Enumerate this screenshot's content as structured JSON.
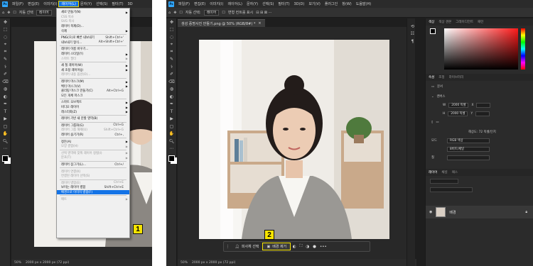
{
  "left": {
    "menubar": {
      "app_icon": "Ps",
      "items": [
        "파일(F)",
        "편집(E)",
        "이미지(I)",
        "레이어(L)",
        "문자(Y)",
        "선택(S)",
        "필터(T)",
        "3D"
      ],
      "active_index": 3
    },
    "optbar": {
      "auto_select": "자동 선택",
      "arrange": "레이어"
    },
    "status": {
      "zoom": "50%",
      "size": "2000 px x 2000 px (72 ppi)"
    },
    "menu": {
      "items": [
        {
          "label": "새로 만들기(N)",
          "shortcut": "",
          "state": "normal",
          "sub": true
        },
        {
          "label": "CSS 복사",
          "shortcut": "",
          "state": "disabled"
        },
        {
          "label": "SVG 복사",
          "shortcut": "",
          "state": "disabled"
        },
        {
          "label": "레이어 복제(D)...",
          "shortcut": "",
          "state": "normal"
        },
        {
          "label": "삭제",
          "shortcut": "",
          "state": "normal",
          "sub": true
        },
        {
          "sep": true
        },
        {
          "label": "PNG(으)로 빠른 내보내기",
          "shortcut": "Shift+Ctrl+'",
          "state": "normal"
        },
        {
          "label": "내보내기 형식...",
          "shortcut": "Alt+Shift+Ctrl+'",
          "state": "normal"
        },
        {
          "sep": true
        },
        {
          "label": "레이어 이름 바꾸기...",
          "shortcut": "",
          "state": "normal"
        },
        {
          "label": "레이어 스타일(Y)",
          "shortcut": "",
          "state": "normal",
          "sub": true
        },
        {
          "label": "스마트 필터",
          "shortcut": "",
          "state": "disabled",
          "sub": true
        },
        {
          "sep": true
        },
        {
          "label": "새 칠 레이어(W)",
          "shortcut": "",
          "state": "normal",
          "sub": true
        },
        {
          "label": "새 조정 레이어(J)",
          "shortcut": "",
          "state": "normal",
          "sub": true
        },
        {
          "label": "레이어 내용 옵션(O)...",
          "shortcut": "",
          "state": "disabled"
        },
        {
          "sep": true
        },
        {
          "label": "레이어 마스크(M)",
          "shortcut": "",
          "state": "normal",
          "sub": true
        },
        {
          "label": "벡터 마스크(V)",
          "shortcut": "",
          "state": "normal",
          "sub": true
        },
        {
          "label": "클리핑 마스크 만들기(C)",
          "shortcut": "Alt+Ctrl+G",
          "state": "normal"
        },
        {
          "label": "모든 개체 마스크",
          "shortcut": "",
          "state": "normal"
        },
        {
          "sep": true
        },
        {
          "label": "스마트 오브젝트",
          "shortcut": "",
          "state": "normal",
          "sub": true
        },
        {
          "label": "비디오 레이어",
          "shortcut": "",
          "state": "normal",
          "sub": true
        },
        {
          "label": "래스터화(Z)",
          "shortcut": "",
          "state": "normal",
          "sub": true
        },
        {
          "sep": true
        },
        {
          "label": "레이어 기반 새 분할 영역(B)",
          "shortcut": "",
          "state": "normal"
        },
        {
          "sep": true
        },
        {
          "label": "레이어 그룹화(G)",
          "shortcut": "Ctrl+G",
          "state": "normal"
        },
        {
          "label": "레이어 그룹 해제(U)",
          "shortcut": "Shift+Ctrl+G",
          "state": "disabled"
        },
        {
          "label": "레이어 숨기기(R)",
          "shortcut": "Ctrl+,",
          "state": "normal"
        },
        {
          "sep": true
        },
        {
          "label": "정돈(A)",
          "shortcut": "",
          "state": "normal",
          "sub": true
        },
        {
          "label": "모양 결합(H)",
          "shortcut": "",
          "state": "disabled",
          "sub": true
        },
        {
          "sep": true
        },
        {
          "label": "선택 영역에 맞춰 레이어 정렬(I)",
          "shortcut": "",
          "state": "disabled",
          "sub": true
        },
        {
          "label": "분포(T)",
          "shortcut": "",
          "state": "disabled",
          "sub": true
        },
        {
          "sep": true
        },
        {
          "label": "레이어 잠그기(L)...",
          "shortcut": "Ctrl+/",
          "state": "normal"
        },
        {
          "sep": true
        },
        {
          "label": "레이어 연결(K)",
          "shortcut": "",
          "state": "disabled"
        },
        {
          "label": "연결된 레이어 선택(S)",
          "shortcut": "",
          "state": "disabled"
        },
        {
          "sep": true
        },
        {
          "label": "레이어 병합(E)",
          "shortcut": "Ctrl+E",
          "state": "disabled"
        },
        {
          "label": "보이는 레이어 병합",
          "shortcut": "Shift+Ctrl+E",
          "state": "normal"
        },
        {
          "label": "배경으로 이미지 병합(F)",
          "shortcut": "",
          "state": "selected"
        },
        {
          "sep": true
        },
        {
          "label": "매트",
          "shortcut": "",
          "state": "disabled",
          "sub": true
        }
      ]
    },
    "badge": "1"
  },
  "right": {
    "menubar": {
      "app_icon": "Ps",
      "items": [
        "파일(F)",
        "편집(E)",
        "이미지(I)",
        "레이어(L)",
        "문자(Y)",
        "선택(S)",
        "필터(T)",
        "3D(D)",
        "보기(V)",
        "플러그인",
        "창(W)",
        "도움말(H)"
      ]
    },
    "optbar": {
      "auto_select": "자동 선택:",
      "arrange": "레이어",
      "transform": "변형 컨트롤 표시"
    },
    "doc_tab": "생성 증명사진 만들기.png @ 50% (RGB/8#) *",
    "context_bar": {
      "subject": "피사체 선택",
      "remove_bg": "배경 제거",
      "more": "•••"
    },
    "badge": "2",
    "status": {
      "zoom": "50%",
      "size": "2000 px x 2000 px (72 ppi)"
    },
    "panels": {
      "color_tabs": [
        "색상",
        "색상 견본",
        "그레이디언트",
        "패턴"
      ],
      "props_tabs": [
        "속성",
        "조정",
        "라이브러리"
      ],
      "props_section": "문서",
      "canvas_label": "캔버스",
      "w_label": "W",
      "w_value": "2000 픽셀",
      "h_label": "H",
      "h_value": "2000 픽셀",
      "x_label": "X",
      "y_label": "Y",
      "resolution": "해상도: 72 픽셀/인치",
      "mode_label": "모드",
      "mode_value": "RGB 색상",
      "depth_value": "8비트/채널",
      "fill_label": "칠",
      "layers_tabs": [
        "레이어",
        "채널",
        "패스"
      ],
      "layer_name": "배경"
    }
  }
}
